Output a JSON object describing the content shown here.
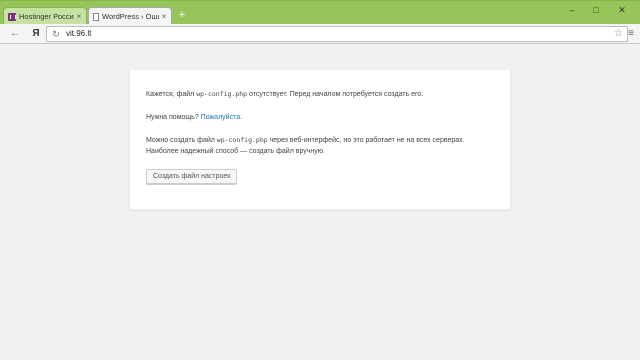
{
  "browser": {
    "tabs": [
      {
        "label": "Hostinger Россия | М..."
      },
      {
        "label": "WordPress › Ошибка"
      }
    ],
    "tab_close_glyph": "×",
    "new_tab_glyph": "+",
    "window_controls": {
      "minimize": "–",
      "maximize": "□",
      "close": "✕"
    },
    "back_glyph": "←",
    "yandex_glyph": "Я",
    "reload_glyph": "↻",
    "url": "vit.96.lt",
    "star_glyph": "☆",
    "menu_glyph": "≡",
    "accent_color": "#96c65a"
  },
  "page": {
    "p1": {
      "before": "Кажется, файл ",
      "code": "wp-config.php",
      "after": " отсутствует. Перед началом потребуется создать его."
    },
    "p2": {
      "text": "Нужна помощь? ",
      "link": "Пожалуйста."
    },
    "p3": {
      "before": "Можно создать файл ",
      "code": "wp-config.php",
      "after": " через веб-интерфейс, но это работает не на всех серверах.",
      "line2": "Наиболее надежный способ — создать файл вручную."
    },
    "button_label": "Создать файл настроек"
  }
}
